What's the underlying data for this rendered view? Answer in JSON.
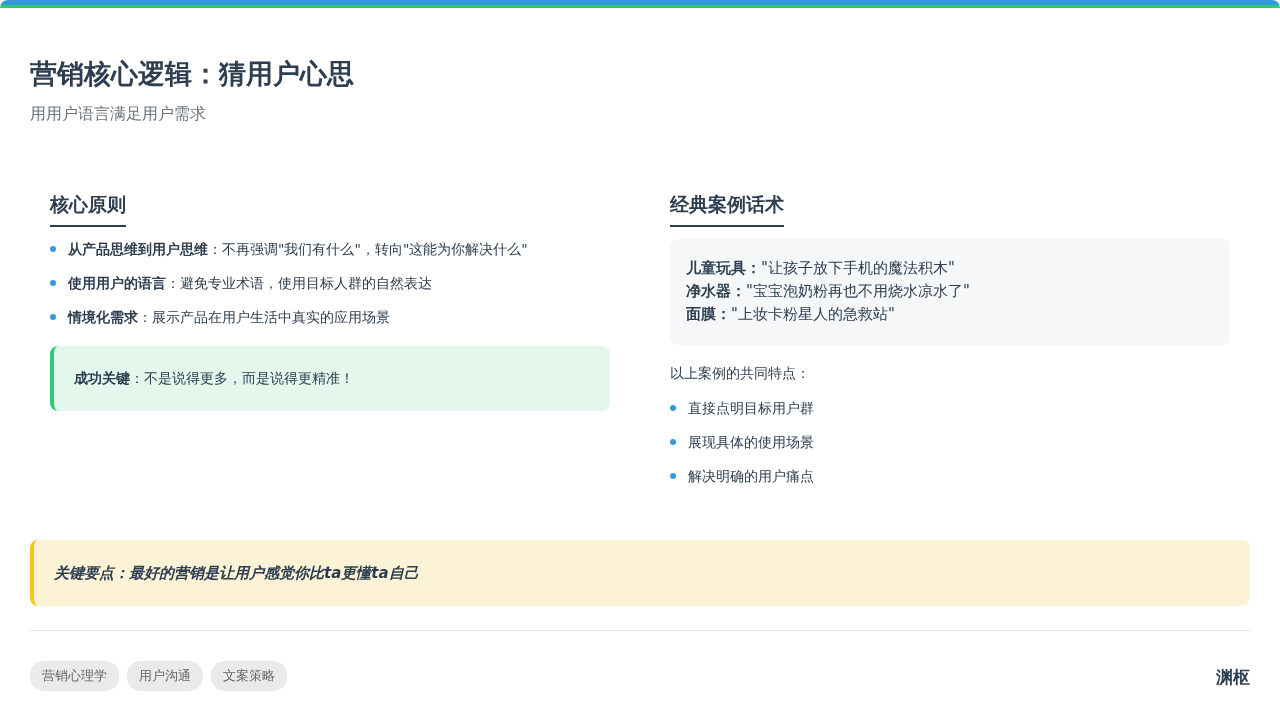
{
  "title": "营销核心逻辑：猜用户心思",
  "subtitle": "用用户语言满足用户需求",
  "principles": {
    "heading": "核心原则",
    "items": [
      "**从产品思维到用户思维**：不再强调\"我们有什么\"，转向\"这能为你解决什么\"",
      "**使用用户的语言**：避免专业术语，使用目标人群的自然表达",
      "**情境化需求**：展示产品在用户生活中真实的应用场景"
    ],
    "callout": "**成功关键**：不是说得更多，而是说得更精准！"
  },
  "cases": {
    "heading": "经典案例话术",
    "examples": [
      "**儿童玩具：**\"让孩子放下手机的魔法积木\"",
      "**净水器：**\"宝宝泡奶粉再也不用烧水凉水了\"",
      "**面膜：**\"上妆卡粉星人的急救站\""
    ],
    "features_intro": "以上案例的共同特点：",
    "features": [
      "直接点明目标用户群",
      "展现具体的使用场景",
      "解决明确的用户痛点"
    ]
  },
  "key_point": "关键要点：最好的营销是让用户感觉你比ta更懂ta自己",
  "tags": [
    "营销心理学",
    "用户沟通",
    "文案策略"
  ],
  "brand": "渊枢"
}
